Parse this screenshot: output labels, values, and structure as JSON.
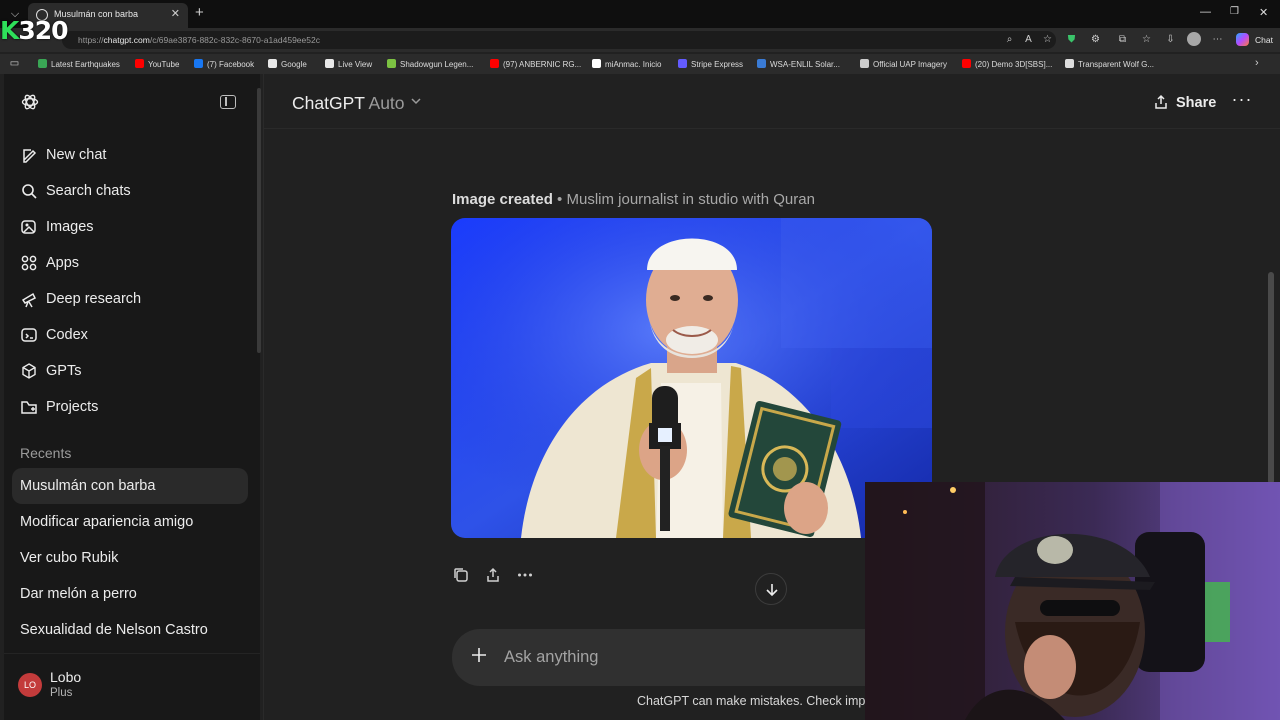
{
  "browser": {
    "tab_title": "Musulmán con barba",
    "overlay_counter": "320",
    "overlay_prefix": "K",
    "url_prefix": "https://",
    "url_host": "chatgpt.com",
    "url_path": "/c/69ae3876-882c-832c-8670-a1ad459ee52c",
    "copilot_label": "Chat",
    "bookmarks": [
      {
        "label": "Latest Earthquakes",
        "color": "#3aa655"
      },
      {
        "label": "YouTube",
        "color": "#ff0000"
      },
      {
        "label": "(7) Facebook",
        "color": "#1877f2"
      },
      {
        "label": "Google",
        "color": "#e8e8e8"
      },
      {
        "label": "Live View",
        "color": "#e8e8e8"
      },
      {
        "label": "Shadowgun Legen...",
        "color": "#7cc242"
      },
      {
        "label": "(97) ANBERNIC RG...",
        "color": "#ff0000"
      },
      {
        "label": "miAnmac. Inicio",
        "color": "#ffffff"
      },
      {
        "label": "Stripe Express",
        "color": "#635bff"
      },
      {
        "label": "WSA-ENLIL Solar...",
        "color": "#3a7bd5"
      },
      {
        "label": "Official UAP Imagery",
        "color": "#cccccc"
      },
      {
        "label": "(20) Demo 3D[SBS]...",
        "color": "#ff0000"
      },
      {
        "label": "Transparent Wolf G...",
        "color": "#dddddd"
      }
    ]
  },
  "sidebar": {
    "nav": [
      {
        "label": "New chat",
        "icon": "new-chat-icon"
      },
      {
        "label": "Search chats",
        "icon": "search-icon"
      },
      {
        "label": "Images",
        "icon": "images-icon"
      },
      {
        "label": "Apps",
        "icon": "apps-icon"
      },
      {
        "label": "Deep research",
        "icon": "telescope-icon"
      },
      {
        "label": "Codex",
        "icon": "codex-icon"
      },
      {
        "label": "GPTs",
        "icon": "gpts-icon"
      },
      {
        "label": "Projects",
        "icon": "folder-icon"
      }
    ],
    "recents_heading": "Recents",
    "recents": [
      {
        "label": "Musulmán con barba",
        "active": true
      },
      {
        "label": "Modificar apariencia amigo",
        "active": false
      },
      {
        "label": "Ver cubo Rubik",
        "active": false
      },
      {
        "label": "Dar melón a perro",
        "active": false
      },
      {
        "label": "Sexualidad de Nelson Castro",
        "active": false
      }
    ],
    "user": {
      "initials": "LO",
      "name": "Lobo",
      "plan": "Plus",
      "avatar_color": "#c33b3b"
    }
  },
  "header": {
    "model_name": "ChatGPT",
    "model_mode": "Auto",
    "share_label": "Share"
  },
  "conversation": {
    "image_status": "Image created",
    "separator": " • ",
    "image_description": "Muslim journalist in studio with Quran"
  },
  "composer": {
    "placeholder": "Ask anything",
    "disclaimer": "ChatGPT can make mistakes. Check importa"
  }
}
